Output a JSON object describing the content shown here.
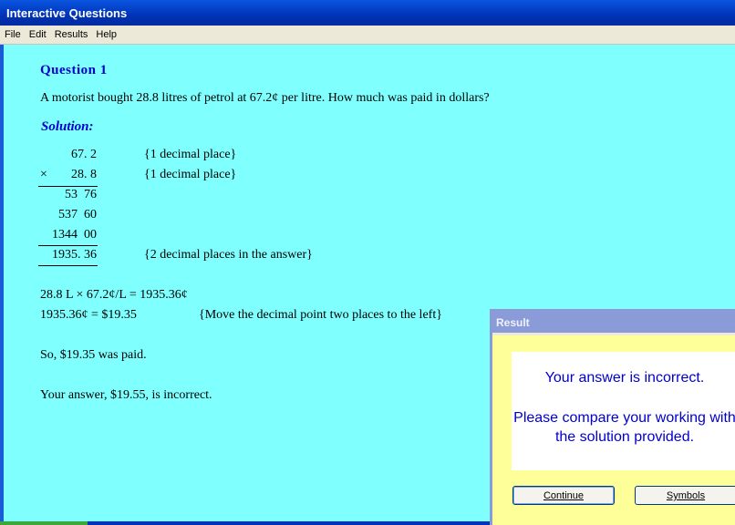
{
  "window": {
    "title": "Interactive Questions"
  },
  "menu": [
    "File",
    "Edit",
    "Results",
    "Help"
  ],
  "question": {
    "heading": "Question 1",
    "text": "A motorist bought 28.8 litres of petrol at 67.2¢ per litre. How much was paid in dollars?"
  },
  "solution": {
    "heading": "Solution:",
    "multiplication": {
      "line1": "67. 2",
      "times_sign": "×",
      "line2": "28. 8",
      "partial1": "53  76",
      "partial2": "537  60",
      "partial3": "1344  00",
      "result": "1935. 36"
    },
    "notes": {
      "n1": "{1 decimal place}",
      "n2": "{1 decimal place}",
      "n3": "{2 decimal places in the answer}"
    },
    "step1": "28.8 L × 67.2¢/L = 1935.36¢",
    "step2": "1935.36¢ = $19.35",
    "step2_note": "{Move the decimal point two places to the left}",
    "conclusion": "So, $19.35 was paid.",
    "feedback": "Your answer, $19.55, is incorrect."
  },
  "dialog": {
    "title": "Result",
    "message1": "Your answer is incorrect.",
    "message2": "Please compare your working with the solution provided.",
    "continue_label": "Continue",
    "symbols_label": "Symbols"
  }
}
